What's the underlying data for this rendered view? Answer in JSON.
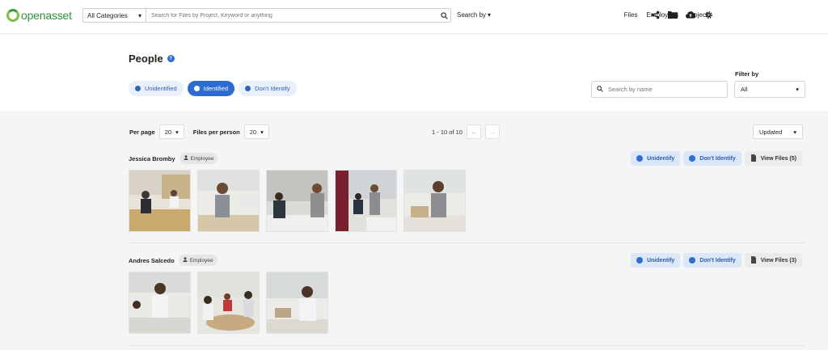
{
  "app": {
    "brand": "openasset"
  },
  "topbar": {
    "category": "All Categories",
    "search_placeholder": "Search for Files by Project, Keyword or anything",
    "search_by": "Search by",
    "nav": [
      "Files",
      "Employees",
      "Projects"
    ],
    "icons": [
      "share-icon",
      "folder-icon",
      "cloud-upload-icon",
      "gear-icon"
    ]
  },
  "header": {
    "title": "People",
    "tabs": [
      {
        "label": "Unidentified",
        "active": false
      },
      {
        "label": "Identified",
        "active": true
      },
      {
        "label": "Don't Identify",
        "active": false
      }
    ],
    "name_search_placeholder": "Search by name",
    "filter_label": "Filter by",
    "filter_value": "All"
  },
  "controls": {
    "per_page_label": "Per page",
    "per_page_value": "20",
    "files_per_person_label": "Files per person",
    "files_per_person_value": "20",
    "range": "1 - 10 of 10",
    "sort": "Updated"
  },
  "people": [
    {
      "name": "Jessica Bromby",
      "role": "Employee",
      "unidentify": "Unidentify",
      "dont_identify": "Don't Identify",
      "view_files": "View Files (5)",
      "thumbnail_count": 5
    },
    {
      "name": "Andres Salcedo",
      "role": "Employee",
      "unidentify": "Unidentify",
      "dont_identify": "Don't Identify",
      "view_files": "View Files (3)",
      "thumbnail_count": 3
    }
  ],
  "colors": {
    "accent": "#2e6bd1",
    "brand_green": "#3a9b3a",
    "chip_blue_bg": "#dce7f7"
  }
}
